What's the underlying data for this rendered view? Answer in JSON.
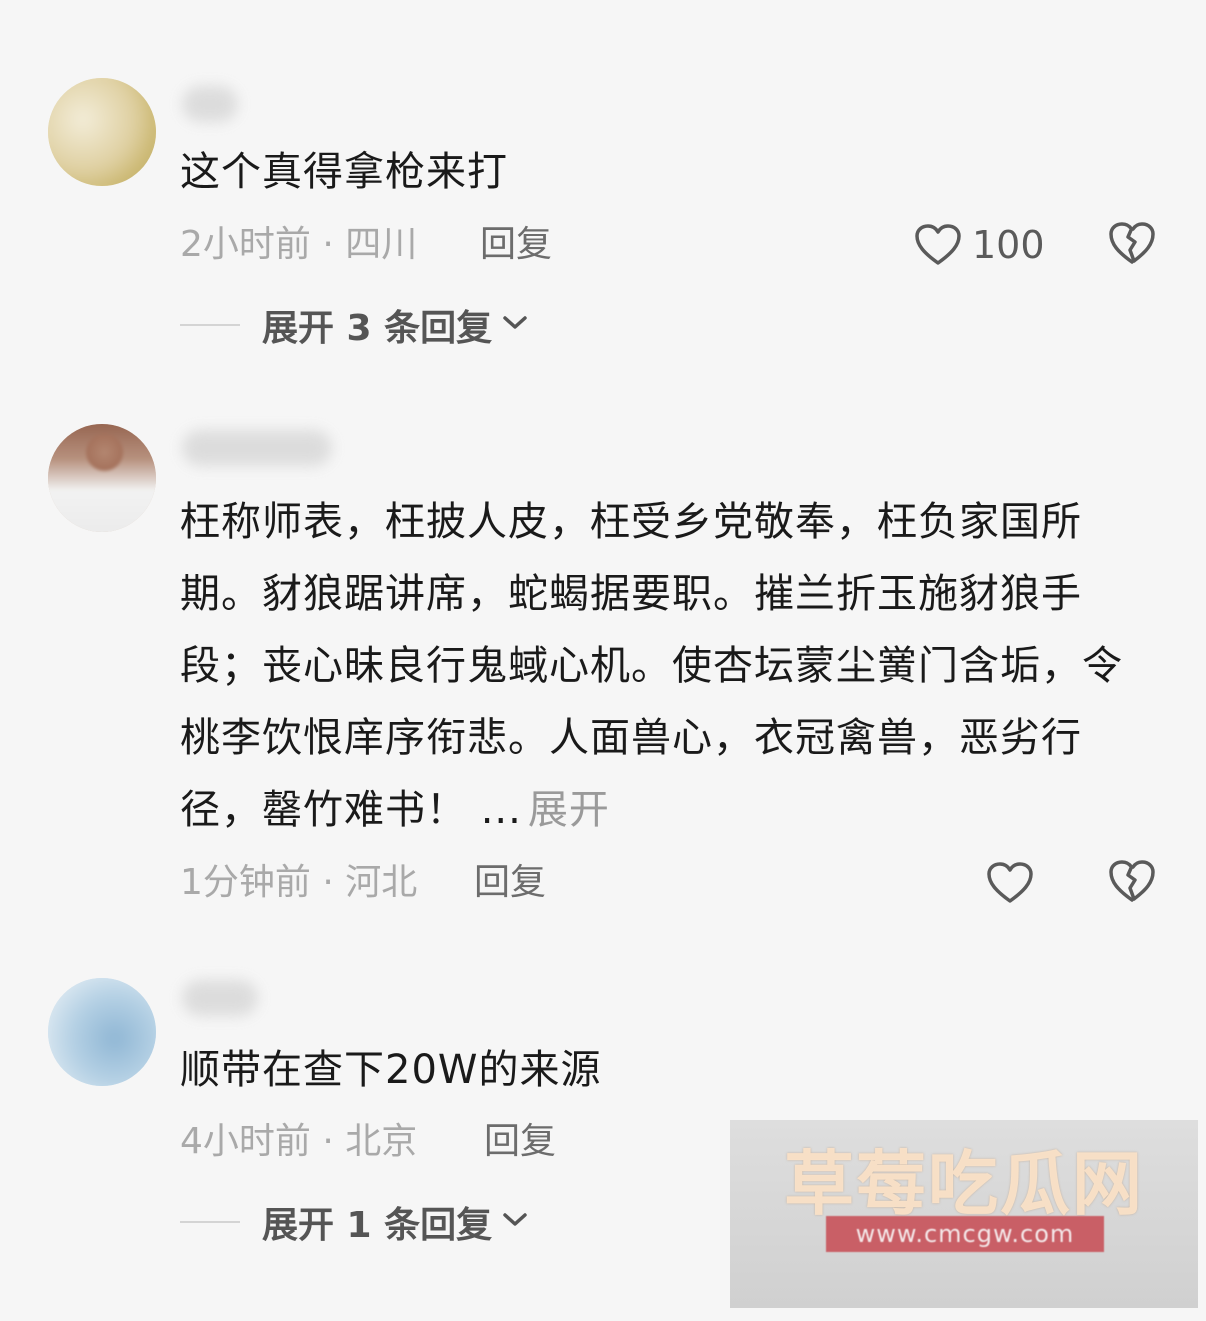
{
  "colors": {
    "background": "#f6f6f6",
    "text_primary": "#1a1a1a",
    "text_meta": "#a9a9a9",
    "reply": "#6c6c6c",
    "thread_text": "#555555",
    "watermark_band": "#c95f66"
  },
  "comments": [
    {
      "text": "这个真得拿枪来打",
      "time_location": "2小时前 · 四川",
      "reply_label": "回复",
      "like_icon": "heart-outline-icon",
      "like_count": "100",
      "dislike_icon": "broken-heart-icon",
      "expand_replies": "展开 3 条回复"
    },
    {
      "text_body": "枉称师表，枉披人皮，枉受乡党敬奉，枉负家国所期。豺狼踞讲席，蛇蝎据要职。摧兰折玉施豺狼手段；丧心昧良行鬼蜮心机。使杏坛蒙尘黉门含垢，令桃李饮恨庠序衔悲。人面兽心，衣冠禽兽，恶劣行径，罄竹难书！",
      "text_tail": "...",
      "expand_label": "展开",
      "time_location": "1分钟前 · 河北",
      "reply_label": "回复",
      "like_icon": "heart-outline-icon",
      "dislike_icon": "broken-heart-icon"
    },
    {
      "text": "顺带在查下20W的来源",
      "time_location": "4小时前 · 北京",
      "reply_label": "回复",
      "expand_replies": "展开 1 条回复"
    }
  ],
  "watermark": {
    "title": "草莓吃瓜网",
    "url": "www.cmcgw.com"
  }
}
